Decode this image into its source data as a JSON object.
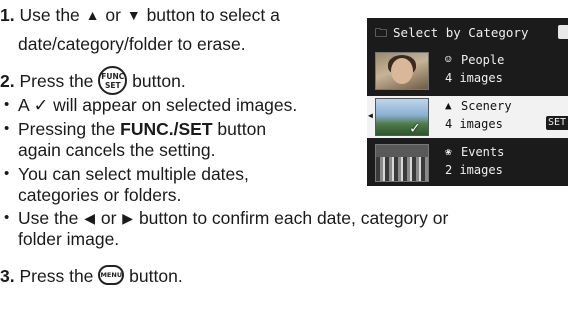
{
  "steps": {
    "step1": {
      "num": "1.",
      "text_a": "Use the",
      "text_b": "or",
      "text_c": "button to select a",
      "line2": "date/category/folder to erase."
    },
    "step2": {
      "num": "2.",
      "text_a": "Press the",
      "text_b": "button."
    },
    "bullets": {
      "b1": "A ✓ will appear on selected images.",
      "b2_a": "Pressing the",
      "b2_bold": "FUNC./SET",
      "b2_b": "button",
      "b2_line2": "again cancels the setting.",
      "b3": "You can select multiple dates,",
      "b3_line2": "categories or folders.",
      "b4_a": "Use the",
      "b4_b": "or",
      "b4_c": "button to confirm each date, category or",
      "b4_line2": "folder image."
    },
    "step3": {
      "num": "3.",
      "text_a": "Press the",
      "text_b": "button."
    }
  },
  "buttons": {
    "func": "FUNC\nSET",
    "menu": "MENU"
  },
  "glyphs": {
    "up": "▲",
    "down": "▼",
    "left": "◀",
    "right": "▶",
    "bullet": "•"
  },
  "lcd": {
    "title": "Select by Category",
    "categories": [
      {
        "icon": "☺",
        "name": "People",
        "count": "4 images",
        "selected": false
      },
      {
        "icon": "▲",
        "name": "Scenery",
        "count": "4 images",
        "selected": true,
        "check": "✓",
        "set_label": "SET"
      },
      {
        "icon": "❀",
        "name": "Events",
        "count": "2 images",
        "selected": false
      }
    ]
  }
}
